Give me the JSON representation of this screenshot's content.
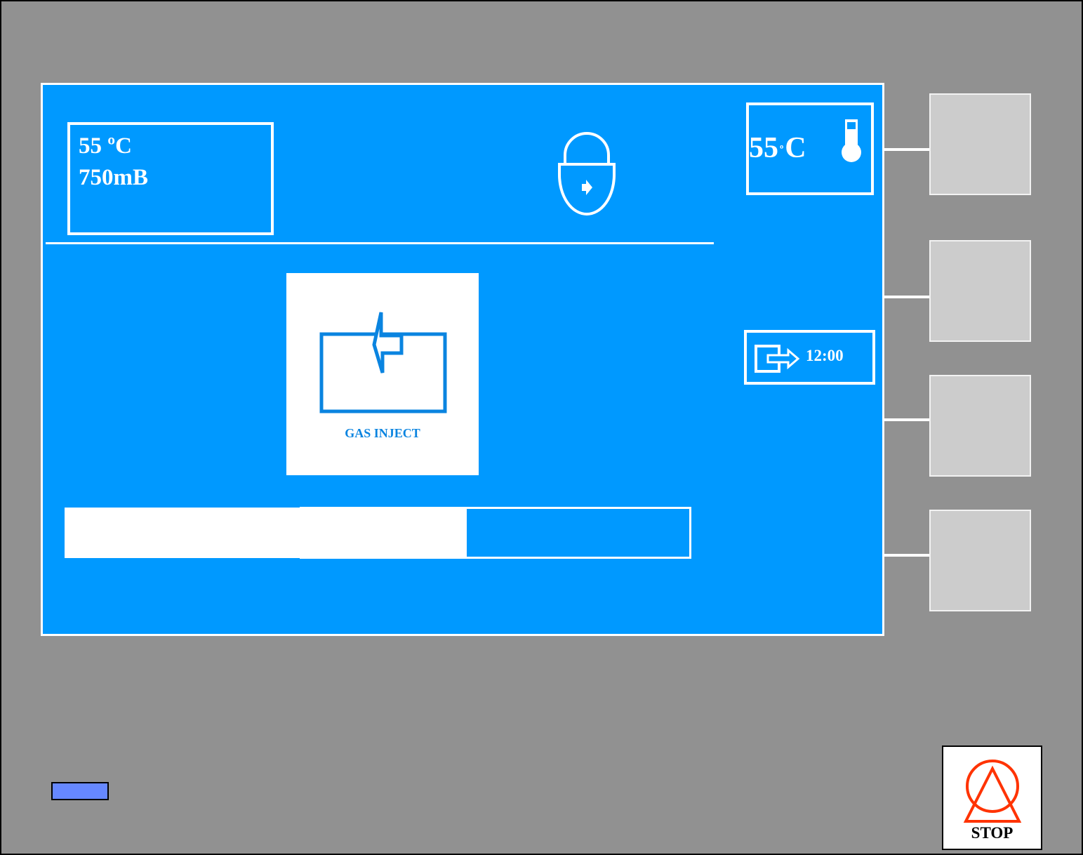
{
  "status": {
    "temperature": "55 ºC",
    "pressure": "750mB"
  },
  "process": {
    "label": "GAS INJECT",
    "icon": "gas-inject-icon",
    "progress": 0.425
  },
  "side_panel": {
    "temperature_number": "55",
    "temperature_degree": "º",
    "temperature_unit": "C",
    "timer": "12:00"
  },
  "stop_button": {
    "label": "STOP"
  },
  "colors": {
    "screen": "#0099ff",
    "bezel": "#919191",
    "softkey": "#cccccc",
    "stop": "#ff3300",
    "indicator": "#6688ff"
  }
}
